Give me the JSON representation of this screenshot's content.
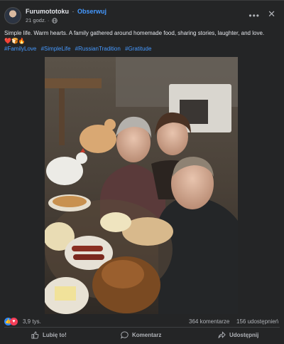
{
  "post": {
    "author": "Furumototoku",
    "separator": "·",
    "follow_label": "Obserwuj",
    "time": "21 godz.",
    "time_sep": "·",
    "caption": "Simple life. Warm hearts. A family gathered around homemade food, sharing stories, laughter, and love.",
    "emojis": "❤️🍞🔥",
    "hashtags": [
      "#FamilyLove",
      "#SimpleLife",
      "#RussianTradition",
      "#Gratitude"
    ]
  },
  "icons": {
    "more": "more-options-icon",
    "close": "close-icon",
    "globe": "globe-icon",
    "like": "thumbs-up-icon",
    "love": "heart-icon",
    "comment": "comment-icon",
    "share": "share-icon"
  },
  "stats": {
    "reactions": "3,9 tys.",
    "comments": "364 komentarze",
    "shares": "156 udostępnień"
  },
  "actions": {
    "like_label": "Lubię to!",
    "comment_label": "Komentarz",
    "share_label": "Udostępnij"
  },
  "colors": {
    "background": "#242526",
    "text": "#e4e6eb",
    "muted": "#b0b3b8",
    "link": "#4599ff",
    "like_blue": "#2e89ff",
    "love_red": "#f33e58"
  }
}
